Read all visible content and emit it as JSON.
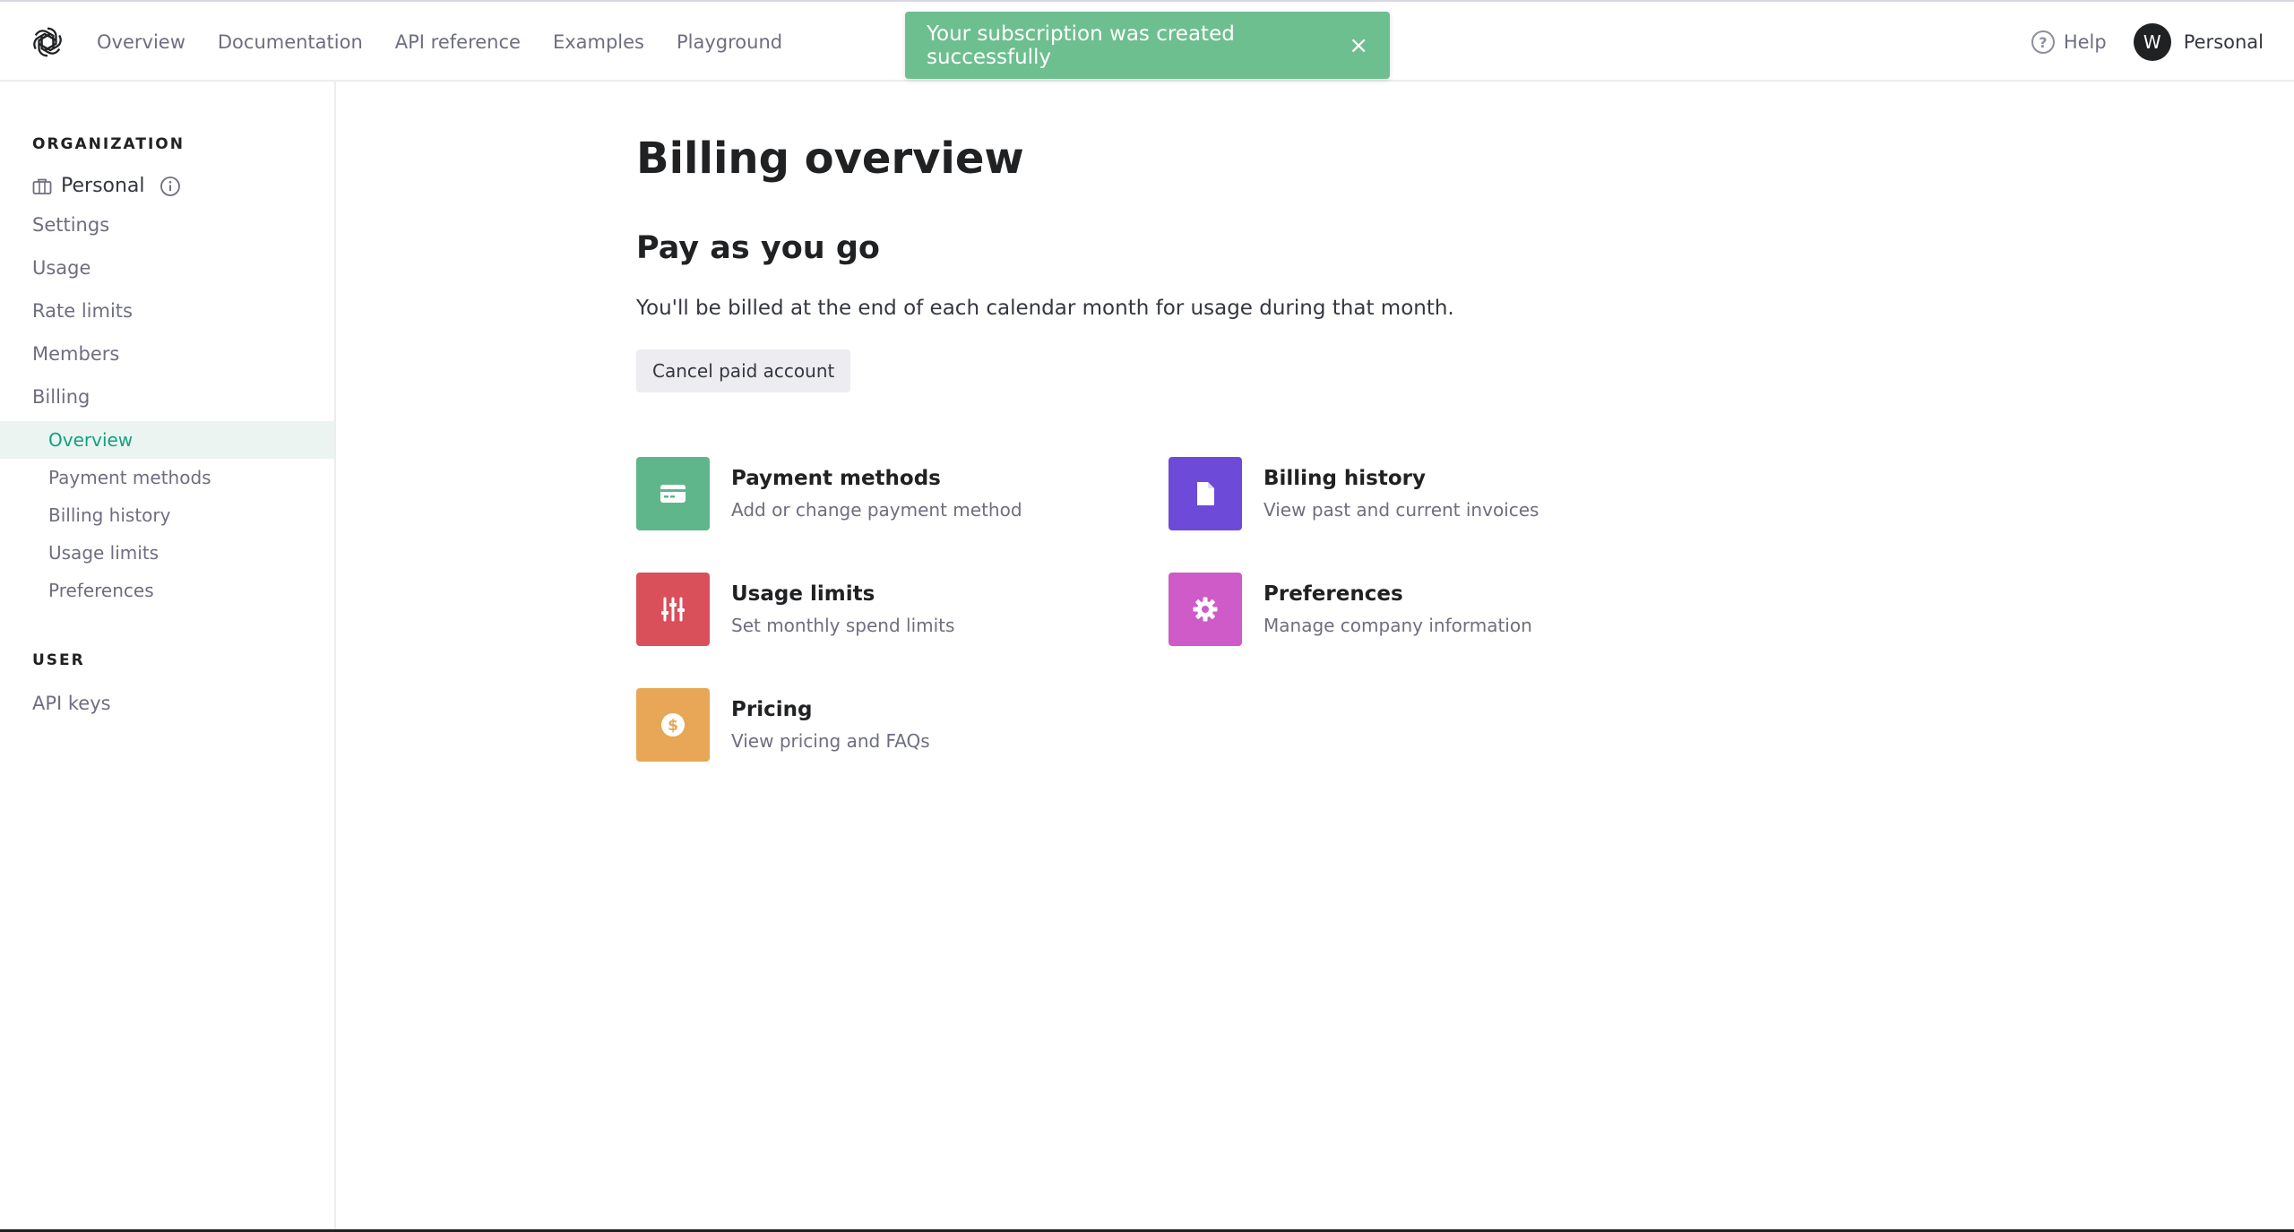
{
  "topnav": {
    "links": [
      "Overview",
      "Documentation",
      "API reference",
      "Examples",
      "Playground"
    ],
    "help": "Help",
    "avatar_initial": "W",
    "account": "Personal"
  },
  "toast": {
    "message": "Your subscription was created successfully",
    "close": "×"
  },
  "sidebar": {
    "org_heading": "ORGANIZATION",
    "org_name": "Personal",
    "items": [
      "Settings",
      "Usage",
      "Rate limits",
      "Members",
      "Billing"
    ],
    "billing_subitems": [
      "Overview",
      "Payment methods",
      "Billing history",
      "Usage limits",
      "Preferences"
    ],
    "user_heading": "USER",
    "user_items": [
      "API keys"
    ]
  },
  "main": {
    "title": "Billing overview",
    "plan_title": "Pay as you go",
    "plan_desc": "You'll be billed at the end of each calendar month for usage during that month.",
    "cancel_label": "Cancel paid account",
    "cards": [
      {
        "title": "Payment methods",
        "subtitle": "Add or change payment method",
        "color": "#5fb68a",
        "icon": "credit-card-icon"
      },
      {
        "title": "Billing history",
        "subtitle": "View past and current invoices",
        "color": "#6d4ad8",
        "icon": "document-icon"
      },
      {
        "title": "Usage limits",
        "subtitle": "Set monthly spend limits",
        "color": "#d9505b",
        "icon": "sliders-icon"
      },
      {
        "title": "Preferences",
        "subtitle": "Manage company information",
        "color": "#cf5bc9",
        "icon": "gear-icon"
      },
      {
        "title": "Pricing",
        "subtitle": "View pricing and FAQs",
        "color": "#e7a756",
        "icon": "dollar-icon"
      }
    ]
  },
  "colors": {
    "accent": "#10a37f",
    "active_bg": "#ecf4f1",
    "toast_bg": "#6dbf8f"
  }
}
